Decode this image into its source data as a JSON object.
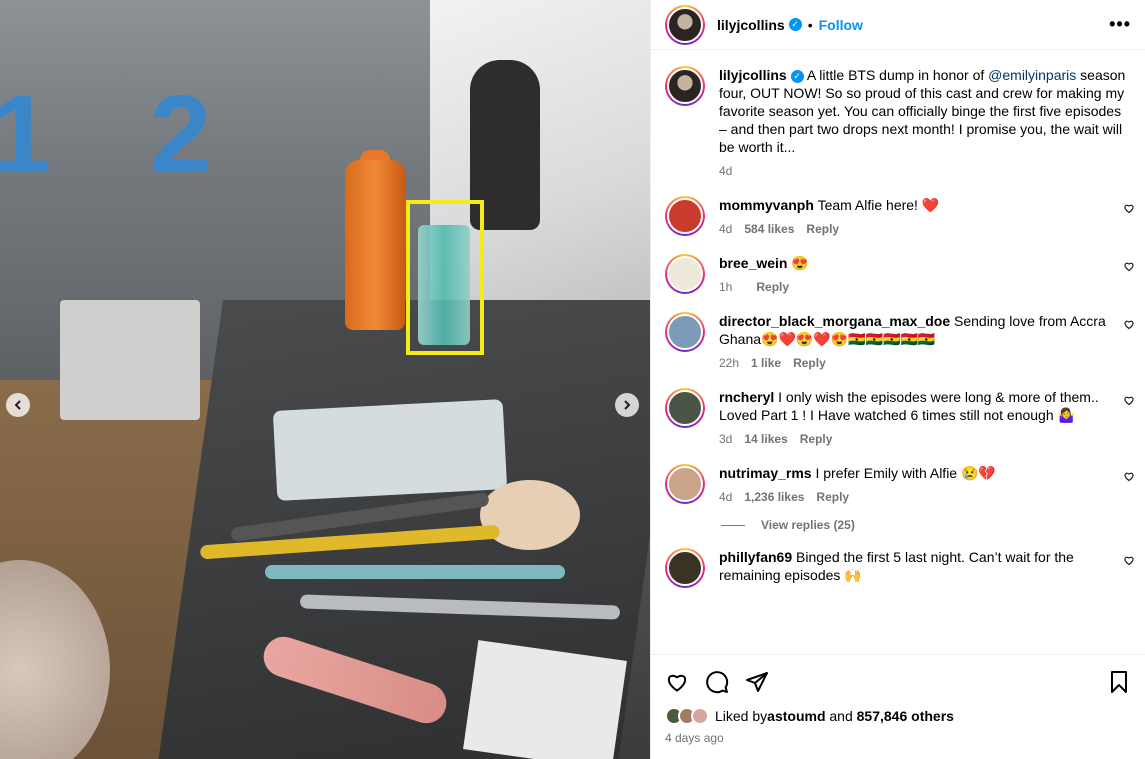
{
  "header": {
    "username": "lilyjcollins",
    "dot": "•",
    "follow_label": "Follow",
    "more_label": "•••"
  },
  "caption": {
    "username": "lilyjcollins",
    "text_before": "A little BTS dump in honor of ",
    "mention": "@emilyinparis",
    "text_after": " season four, OUT NOW! So so proud of this cast and crew for making my favorite season yet. You can officially binge the first five episodes – and then part two drops next month! I promise you, the wait will be worth it...",
    "time": "4d"
  },
  "media": {
    "locker_numbers": [
      "1",
      "2"
    ],
    "highlight_color": "#f4ec1a"
  },
  "comments": [
    {
      "username": "mommyvanph",
      "text": "Team Alfie here! ❤️",
      "time": "4d",
      "likes": "584 likes",
      "reply": "Reply",
      "avatar_color": "#c93b2c"
    },
    {
      "username": "bree_wein",
      "text": "😍",
      "time": "1h",
      "likes": "",
      "reply": "Reply",
      "avatar_color": "#efe9dc"
    },
    {
      "username": "director_black_morgana_max_doe",
      "text": "Sending love from Accra Ghana😍❤️😍❤️😍🇬🇭🇬🇭🇬🇭🇬🇭🇬🇭",
      "time": "22h",
      "likes": "1 like",
      "reply": "Reply",
      "avatar_color": "#7b9bb8"
    },
    {
      "username": "rncheryl",
      "text": "I only wish the episodes were long & more of them.. Loved Part 1 ! I Have watched 6 times still not enough 🤷‍♀️",
      "time": "3d",
      "likes": "14 likes",
      "reply": "Reply",
      "avatar_color": "#4a5548"
    },
    {
      "username": "nutrimay_rms",
      "text": "I prefer Emily with Alfie 😢💔",
      "time": "4d",
      "likes": "1,236 likes",
      "reply": "Reply",
      "avatar_color": "#c9a489"
    },
    {
      "username": "phillyfan69",
      "text": "Binged the first 5 last night. Can’t wait for the remaining episodes 🙌",
      "time": "",
      "likes": "",
      "reply": "",
      "avatar_color": "#3b3226"
    }
  ],
  "view_replies": "View replies (25)",
  "likes": {
    "prefix": "Liked by ",
    "user": "astoumd",
    "middle": " and ",
    "others": "857,846 others"
  },
  "post_time": "4 days ago",
  "icons": [
    "heart-icon",
    "comment-icon",
    "share-icon",
    "bookmark-icon",
    "verified-badge-icon",
    "chevron-left-icon",
    "chevron-right-icon"
  ]
}
